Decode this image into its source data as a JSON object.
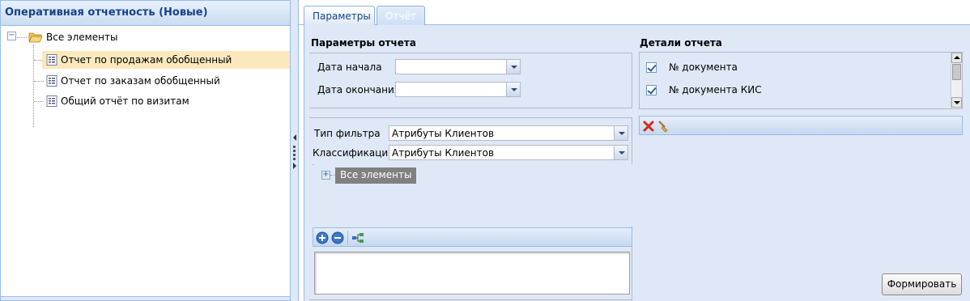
{
  "left_panel": {
    "title": "Оперативная отчетность (Новые)",
    "tree": {
      "root_label": "Все элементы",
      "items": [
        {
          "label": "Отчет по продажам обобщенный",
          "selected": true
        },
        {
          "label": "Отчет по заказам обобщенный",
          "selected": false
        },
        {
          "label": "Общий отчёт по визитам",
          "selected": false
        }
      ]
    }
  },
  "tabs": [
    {
      "label": "Параметры",
      "active": true
    },
    {
      "label": "Отчёт",
      "active": false
    }
  ],
  "report_params": {
    "title": "Параметры отчета",
    "start_date_label": "Дата начала",
    "start_date_value": "",
    "end_date_label": "Дата окончания",
    "end_date_value": ""
  },
  "filter": {
    "type_label": "Тип фильтра",
    "type_value": "Атрибуты Клиентов",
    "classification_label": "Классификация",
    "classification_value": "Атрибуты Клиентов",
    "tree_root_label": "Все элементы",
    "toolbar_icons": [
      "add-icon",
      "remove-icon",
      "hierarchy-icon"
    ],
    "text_value": ""
  },
  "report_details": {
    "title": "Детали отчета",
    "items": [
      {
        "label": "№ документа",
        "checked": true
      },
      {
        "label": "№ документа КИС",
        "checked": true
      }
    ],
    "toolbar_icons": [
      "delete-icon",
      "clear-icon"
    ]
  },
  "actions": {
    "generate_label": "Формировать"
  },
  "colors": {
    "panel_bg": "#dfe8f6",
    "border": "#99bbe8",
    "header_text": "#15428b",
    "selected_row": "#fbe9bd"
  }
}
